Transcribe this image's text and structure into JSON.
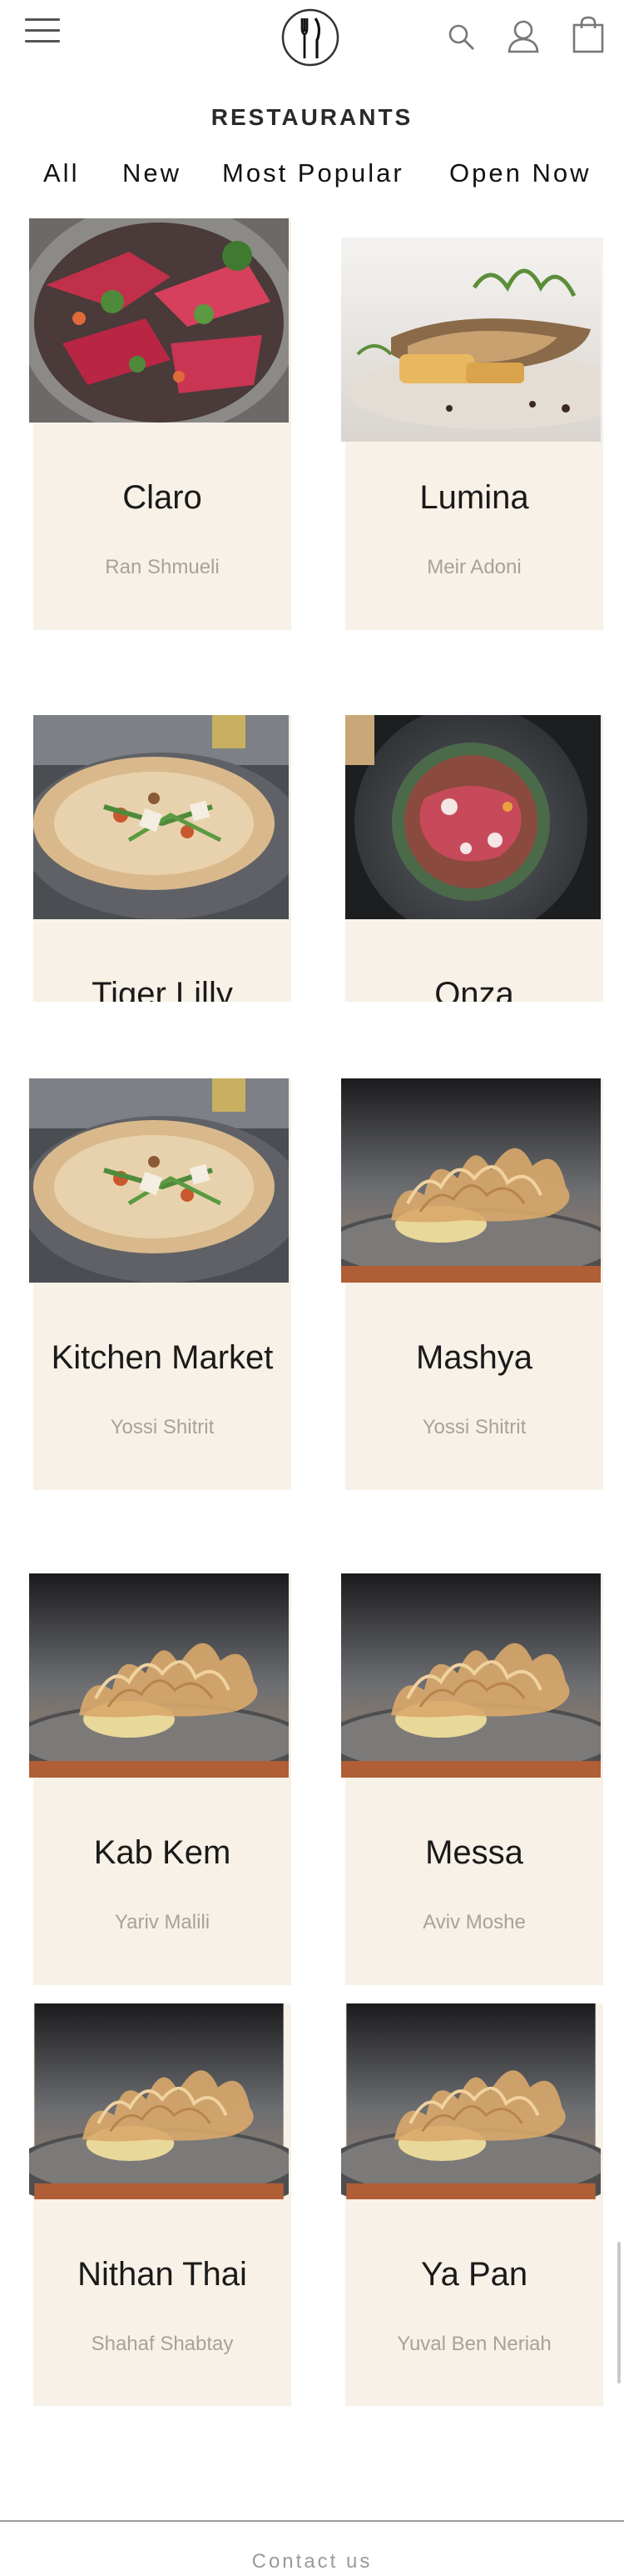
{
  "header": {
    "menu_icon": "hamburger-menu-icon",
    "logo_icon": "fork-knife-logo-icon",
    "search_icon": "search-icon",
    "user_icon": "user-icon",
    "cart_icon": "shopping-bag-icon"
  },
  "page": {
    "title": "RESTAURANTS"
  },
  "filters": [
    "All",
    "New",
    "Most Popular",
    "Open Now"
  ],
  "restaurants": [
    {
      "name": "Claro",
      "chef": "Ran Shmueli",
      "image": "red-ceviche-bowl"
    },
    {
      "name": "Lumina",
      "chef": "Meir Adoni",
      "image": "fish-with-greens"
    },
    {
      "name": "Tiger Lilly",
      "chef": "",
      "image": "pizza-with-greens"
    },
    {
      "name": "Onza",
      "chef": "",
      "image": "carpaccio-plate"
    },
    {
      "name": "Kitchen Market",
      "chef": "Yossi Shitrit",
      "image": "pizza-with-greens"
    },
    {
      "name": "Mashya",
      "chef": "Yossi Shitrit",
      "image": "golden-sugar-dessert"
    },
    {
      "name": "Kab Kem",
      "chef": "Yariv Malili",
      "image": "golden-sugar-dessert"
    },
    {
      "name": "Messa",
      "chef": "Aviv Moshe",
      "image": "golden-sugar-dessert"
    },
    {
      "name": "Nithan Thai",
      "chef": "Shahaf Shabtay",
      "image": "golden-sugar-dessert"
    },
    {
      "name": "Ya Pan",
      "chef": "Yuval Ben Neriah",
      "image": "golden-sugar-dessert"
    }
  ],
  "footer": {
    "contact": "Contact us"
  },
  "colors": {
    "card_bg": "#f7f1e7",
    "text": "#1a1a1a",
    "muted": "#a8a29a"
  }
}
